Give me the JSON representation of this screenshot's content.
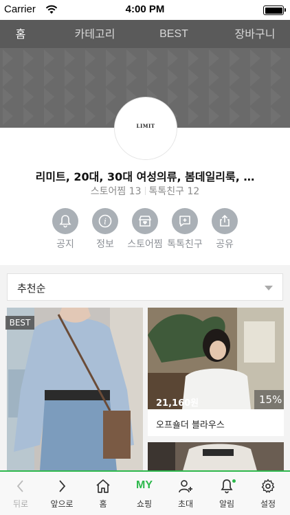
{
  "status_bar": {
    "carrier": "Carrier",
    "time": "4:00 PM"
  },
  "nav": {
    "tabs": [
      "홈",
      "카테고리",
      "BEST",
      "장바구니"
    ]
  },
  "store": {
    "logo_text": "LIMIT",
    "title": "리미트, 20대, 30대 여성의류, 봄데일리룩, …",
    "stat_favorites": "스토어찜 13",
    "stat_friends": "톡톡친구 12"
  },
  "actions": [
    {
      "label": "공지",
      "icon": "bell-icon"
    },
    {
      "label": "정보",
      "icon": "info-icon"
    },
    {
      "label": "스토어찜",
      "icon": "store-heart-icon"
    },
    {
      "label": "톡톡친구",
      "icon": "chat-plus-icon"
    },
    {
      "label": "공유",
      "icon": "share-icon"
    }
  ],
  "sort": {
    "selected": "추천순"
  },
  "products": [
    {
      "badge": "BEST"
    },
    {
      "price": "21,160원",
      "discount": "15%",
      "name": "오프숄더 블라우스"
    }
  ],
  "bottom_tabs": [
    {
      "label": "뒤로",
      "icon": "chevron-left-icon"
    },
    {
      "label": "앞으로",
      "icon": "chevron-right-icon"
    },
    {
      "label": "홈",
      "icon": "home-icon"
    },
    {
      "label": "쇼핑",
      "icon": "my-shopping-icon",
      "icon_text": "MY"
    },
    {
      "label": "초대",
      "icon": "invite-user-icon"
    },
    {
      "label": "알림",
      "icon": "bell-icon"
    },
    {
      "label": "설정",
      "icon": "gear-icon"
    }
  ],
  "colors": {
    "accent": "#2db84c",
    "nav_bg": "#5a5a5a",
    "icon_circle": "#aab0b6"
  }
}
